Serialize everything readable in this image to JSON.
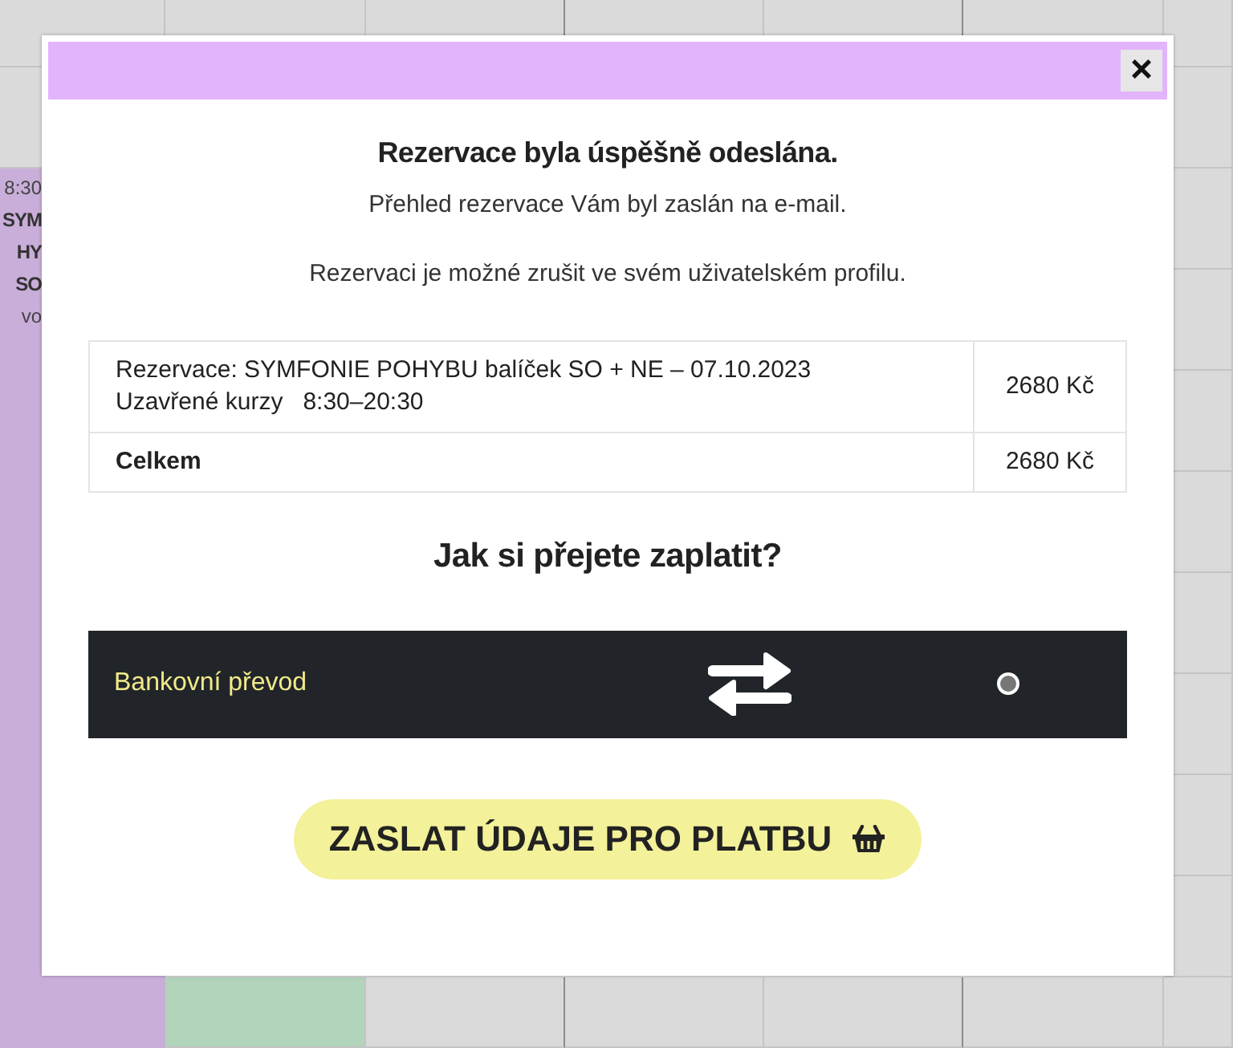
{
  "background_event": {
    "texts": [
      "8:30",
      "SYM",
      "HY",
      "SO",
      "vo"
    ]
  },
  "dialog": {
    "close_label": "×",
    "title": "Rezervace byla úspěšně odeslána.",
    "messages": [
      "Přehled rezervace Vám byl zaslán na e-mail.",
      "Rezervaci je možné zrušit ve svém uživatelském profilu."
    ],
    "summary": [
      {
        "kind": "item",
        "lines": [
          "Rezervace: SYMFONIE POHYBU balíček SO + NE – 07.10.2023",
          "Uzavřené kurzy   8:30–20:30"
        ],
        "price": "2680 Kč"
      },
      {
        "kind": "total",
        "lines": [
          "Celkem"
        ],
        "price": "2680 Kč"
      }
    ],
    "payment_question": "Jak si přejete zaplatit?",
    "payment_methods": [
      {
        "label": "Bankovní převod",
        "selected": false
      }
    ],
    "submit_button": "ZASLAT ÚDAJE PRO PLATBU"
  }
}
